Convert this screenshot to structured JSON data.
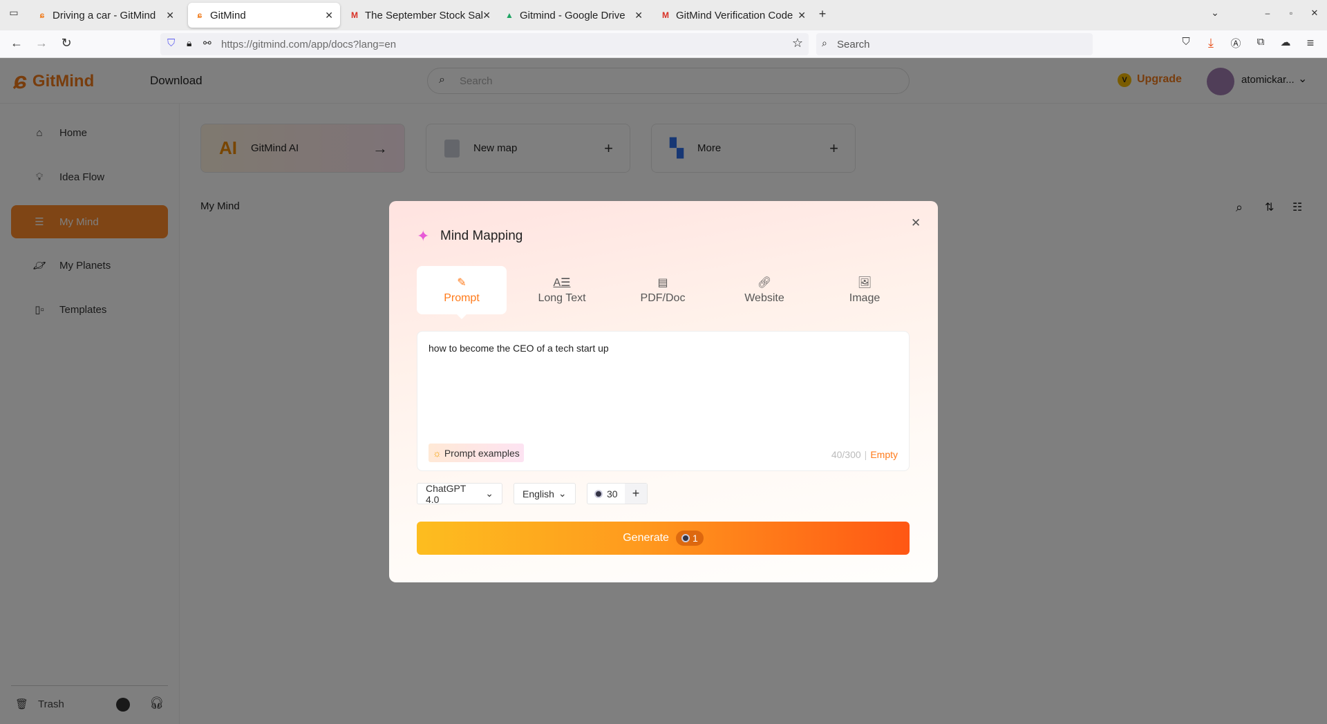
{
  "browser": {
    "tabs": [
      {
        "label": "Driving a car - GitMind",
        "icon": "gitmind-icon",
        "active": false
      },
      {
        "label": "GitMind",
        "icon": "gitmind-icon",
        "active": true
      },
      {
        "label": "The September Stock Sale",
        "icon": "gmail-icon",
        "active": false
      },
      {
        "label": "Gitmind - Google Drive",
        "icon": "google-drive-icon",
        "active": false
      },
      {
        "label": "GitMind Verification Code",
        "icon": "gmail-icon",
        "active": false
      }
    ],
    "url": "https://gitmind.com/app/docs?lang=en",
    "search_placeholder": "Search"
  },
  "header": {
    "logo": "GitMind",
    "download": "Download",
    "search_placeholder": "Search",
    "upgrade": "Upgrade",
    "username": "atomickar..."
  },
  "sidebar": {
    "items": [
      {
        "label": "Home",
        "icon": "home-icon"
      },
      {
        "label": "Idea Flow",
        "icon": "lightbulb-icon"
      },
      {
        "label": "My Mind",
        "icon": "document-icon",
        "active": true
      },
      {
        "label": "My Planets",
        "icon": "planet-icon"
      },
      {
        "label": "Templates",
        "icon": "templates-icon"
      }
    ],
    "trash": "Trash"
  },
  "main": {
    "cards": [
      {
        "label": "GitMind AI",
        "badge": "AI"
      },
      {
        "label": "New map"
      },
      {
        "label": "More"
      }
    ],
    "section_title": "My Mind"
  },
  "modal": {
    "title": "Mind Mapping",
    "tabs": [
      {
        "label": "Prompt",
        "active": true
      },
      {
        "label": "Long Text"
      },
      {
        "label": "PDF/Doc"
      },
      {
        "label": "Website"
      },
      {
        "label": "Image"
      }
    ],
    "prompt_text": "how to become the CEO of a tech start up",
    "prompt_examples": "Prompt examples",
    "char_count": "40/300",
    "separator": "|",
    "empty": "Empty",
    "model": "ChatGPT 4.0",
    "language": "English",
    "credits": "30",
    "generate": "Generate",
    "generate_cost": "1"
  },
  "colors": {
    "accent": "#ff7a1a",
    "active_sidebar": "#ff8a2b"
  }
}
